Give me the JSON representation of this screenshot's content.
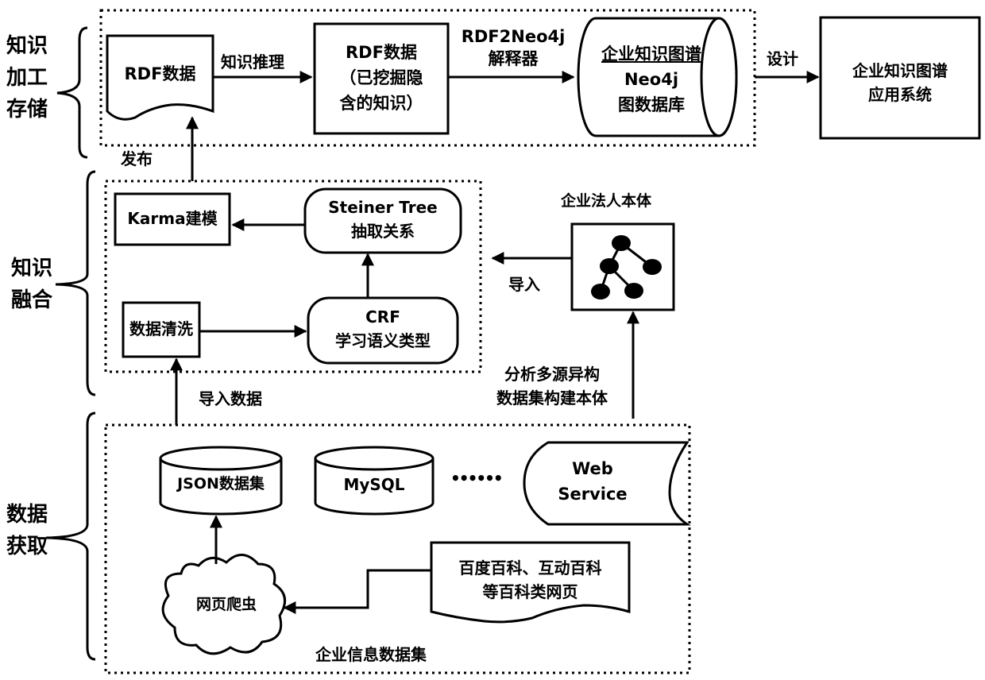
{
  "stages": {
    "storage": [
      "知识",
      "加工",
      "存储"
    ],
    "fusion": [
      "知识",
      "融合"
    ],
    "acquisition": [
      "数据",
      "获取"
    ]
  },
  "storage_layer": {
    "rdf_data": "RDF数据",
    "reasoning_label": "知识推理",
    "mined_rdf": [
      "RDF数据",
      "（已挖掘隐",
      "含的知识）"
    ],
    "converter_label": [
      "RDF2Neo4j",
      "解释器"
    ],
    "neo4j_db": [
      "企业知识图谱",
      "Neo4j",
      "图数据库"
    ],
    "design_label": "设计",
    "application": [
      "企业知识图谱",
      "应用系统"
    ],
    "publish_label": "发布"
  },
  "fusion_layer": {
    "karma": "Karma建模",
    "steiner": [
      "Steiner Tree",
      "抽取关系"
    ],
    "cleaning": "数据清洗",
    "crf": [
      "CRF",
      "学习语义类型"
    ],
    "ontology_title": "企业法人本体",
    "import_label": "导入",
    "import_data_label": "导入数据",
    "build_ontology_label": [
      "分析多源异构",
      "数据集构建本体"
    ]
  },
  "acquisition_layer": {
    "json_dataset": "JSON数据集",
    "mysql": "MySQL",
    "ellipsis": "••••••",
    "web_service": [
      "Web",
      "Service"
    ],
    "crawler": "网页爬虫",
    "encyclopedia": [
      "百度百科、互动百科",
      "等百科类网页"
    ],
    "dataset_title": "企业信息数据集"
  }
}
